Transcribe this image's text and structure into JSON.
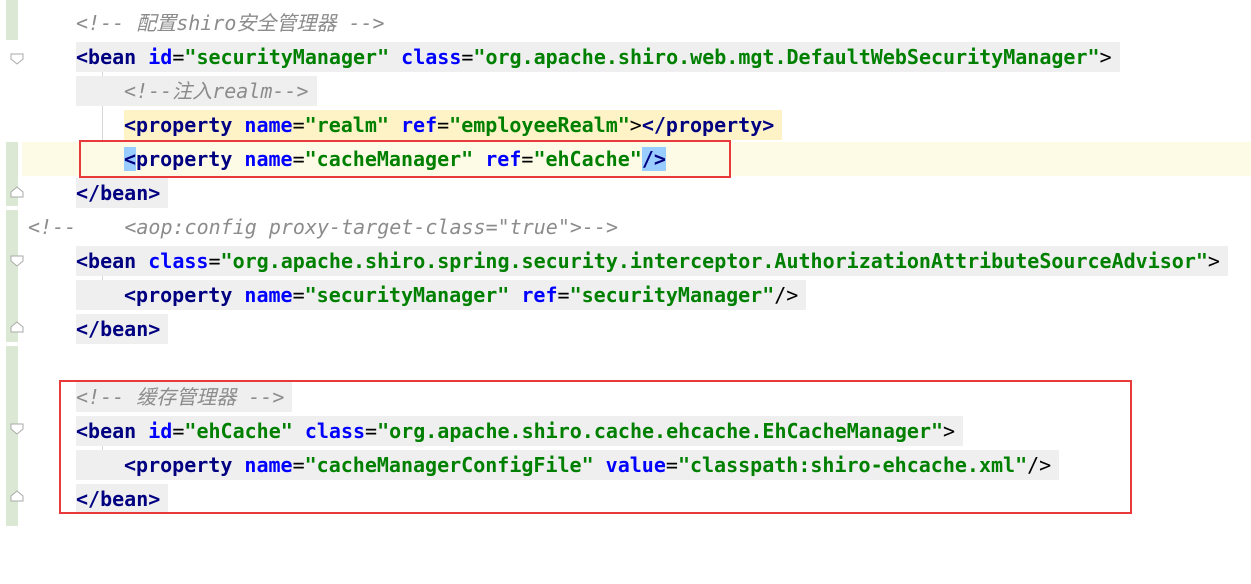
{
  "lines": {
    "l1": {
      "comment": "<!-- 配置shiro安全管理器 -->"
    },
    "l2": {
      "tag": "<bean",
      "attr1": "id",
      "val1": "\"securityManager\"",
      "attr2": "class",
      "val2": "\"org.apache.shiro.web.mgt.DefaultWebSecurityManager\"",
      "close": ">"
    },
    "l3": {
      "comment": "<!--注入realm-->"
    },
    "l4": {
      "tag": "<property",
      "attr1": "name",
      "val1": "\"realm\"",
      "attr2": "ref",
      "val2": "\"employeeRealm\"",
      "close": ">",
      "endtag": "</property>"
    },
    "l5": {
      "lt": "<",
      "tag": "property",
      "attr1": "name",
      "val1": "\"cacheManager\"",
      "attr2": "ref",
      "val2": "\"ehCache\"",
      "close": "/>"
    },
    "l6": {
      "tag": "</bean>"
    },
    "l7": {
      "open": "<!--",
      "comment": "<aop:config proxy-target-class=\"true\">-->"
    },
    "l8": {
      "tag": "<bean",
      "attr1": "class",
      "val1": "\"org.apache.shiro.spring.security.interceptor.AuthorizationAttributeSourceAdvisor\"",
      "close": ">"
    },
    "l9": {
      "tag": "<property",
      "attr1": "name",
      "val1": "\"securityManager\"",
      "attr2": "ref",
      "val2": "\"securityManager\"",
      "close": "/>"
    },
    "l10": {
      "tag": "</bean>"
    },
    "l12": {
      "comment": "<!-- 缓存管理器 -->"
    },
    "l13": {
      "tag": "<bean",
      "attr1": "id",
      "val1": "\"ehCache\"",
      "attr2": "class",
      "val2": "\"org.apache.shiro.cache.ehcache.EhCacheManager\"",
      "close": ">"
    },
    "l14": {
      "tag": "<property",
      "attr1": "name",
      "val1": "\"cacheManagerConfigFile\"",
      "attr2": "value",
      "val2": "\"classpath:shiro-ehcache.xml\"",
      "close": "/>"
    },
    "l15": {
      "tag": "</bean>"
    }
  },
  "colors": {
    "tag": "#000080",
    "attribute": "#0000ff",
    "value": "#008000",
    "comment": "#8c8c8c",
    "highlight_box": "#e83a3a"
  },
  "icons": {
    "fold_marker": "fold-marker-icon"
  }
}
